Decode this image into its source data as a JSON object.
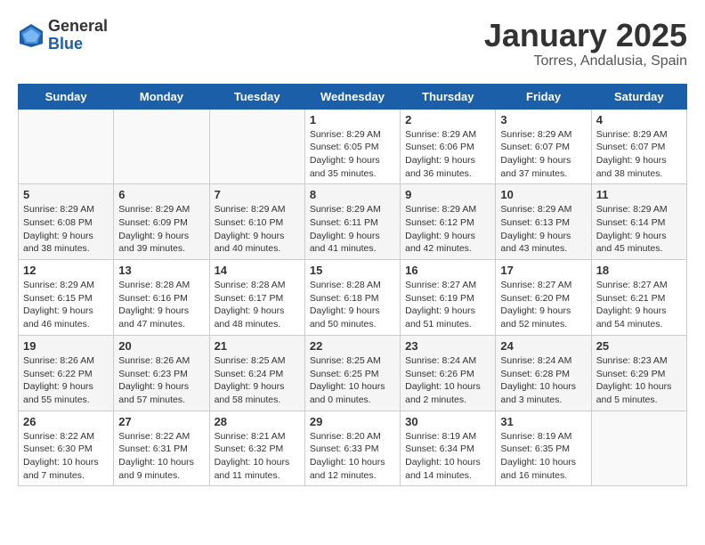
{
  "header": {
    "logo_general": "General",
    "logo_blue": "Blue",
    "month_title": "January 2025",
    "location": "Torres, Andalusia, Spain"
  },
  "days_of_week": [
    "Sunday",
    "Monday",
    "Tuesday",
    "Wednesday",
    "Thursday",
    "Friday",
    "Saturday"
  ],
  "weeks": [
    {
      "shaded": false,
      "days": [
        {
          "num": "",
          "info": ""
        },
        {
          "num": "",
          "info": ""
        },
        {
          "num": "",
          "info": ""
        },
        {
          "num": "1",
          "info": "Sunrise: 8:29 AM\nSunset: 6:05 PM\nDaylight: 9 hours\nand 35 minutes."
        },
        {
          "num": "2",
          "info": "Sunrise: 8:29 AM\nSunset: 6:06 PM\nDaylight: 9 hours\nand 36 minutes."
        },
        {
          "num": "3",
          "info": "Sunrise: 8:29 AM\nSunset: 6:07 PM\nDaylight: 9 hours\nand 37 minutes."
        },
        {
          "num": "4",
          "info": "Sunrise: 8:29 AM\nSunset: 6:07 PM\nDaylight: 9 hours\nand 38 minutes."
        }
      ]
    },
    {
      "shaded": true,
      "days": [
        {
          "num": "5",
          "info": "Sunrise: 8:29 AM\nSunset: 6:08 PM\nDaylight: 9 hours\nand 38 minutes."
        },
        {
          "num": "6",
          "info": "Sunrise: 8:29 AM\nSunset: 6:09 PM\nDaylight: 9 hours\nand 39 minutes."
        },
        {
          "num": "7",
          "info": "Sunrise: 8:29 AM\nSunset: 6:10 PM\nDaylight: 9 hours\nand 40 minutes."
        },
        {
          "num": "8",
          "info": "Sunrise: 8:29 AM\nSunset: 6:11 PM\nDaylight: 9 hours\nand 41 minutes."
        },
        {
          "num": "9",
          "info": "Sunrise: 8:29 AM\nSunset: 6:12 PM\nDaylight: 9 hours\nand 42 minutes."
        },
        {
          "num": "10",
          "info": "Sunrise: 8:29 AM\nSunset: 6:13 PM\nDaylight: 9 hours\nand 43 minutes."
        },
        {
          "num": "11",
          "info": "Sunrise: 8:29 AM\nSunset: 6:14 PM\nDaylight: 9 hours\nand 45 minutes."
        }
      ]
    },
    {
      "shaded": false,
      "days": [
        {
          "num": "12",
          "info": "Sunrise: 8:29 AM\nSunset: 6:15 PM\nDaylight: 9 hours\nand 46 minutes."
        },
        {
          "num": "13",
          "info": "Sunrise: 8:28 AM\nSunset: 6:16 PM\nDaylight: 9 hours\nand 47 minutes."
        },
        {
          "num": "14",
          "info": "Sunrise: 8:28 AM\nSunset: 6:17 PM\nDaylight: 9 hours\nand 48 minutes."
        },
        {
          "num": "15",
          "info": "Sunrise: 8:28 AM\nSunset: 6:18 PM\nDaylight: 9 hours\nand 50 minutes."
        },
        {
          "num": "16",
          "info": "Sunrise: 8:27 AM\nSunset: 6:19 PM\nDaylight: 9 hours\nand 51 minutes."
        },
        {
          "num": "17",
          "info": "Sunrise: 8:27 AM\nSunset: 6:20 PM\nDaylight: 9 hours\nand 52 minutes."
        },
        {
          "num": "18",
          "info": "Sunrise: 8:27 AM\nSunset: 6:21 PM\nDaylight: 9 hours\nand 54 minutes."
        }
      ]
    },
    {
      "shaded": true,
      "days": [
        {
          "num": "19",
          "info": "Sunrise: 8:26 AM\nSunset: 6:22 PM\nDaylight: 9 hours\nand 55 minutes."
        },
        {
          "num": "20",
          "info": "Sunrise: 8:26 AM\nSunset: 6:23 PM\nDaylight: 9 hours\nand 57 minutes."
        },
        {
          "num": "21",
          "info": "Sunrise: 8:25 AM\nSunset: 6:24 PM\nDaylight: 9 hours\nand 58 minutes."
        },
        {
          "num": "22",
          "info": "Sunrise: 8:25 AM\nSunset: 6:25 PM\nDaylight: 10 hours\nand 0 minutes."
        },
        {
          "num": "23",
          "info": "Sunrise: 8:24 AM\nSunset: 6:26 PM\nDaylight: 10 hours\nand 2 minutes."
        },
        {
          "num": "24",
          "info": "Sunrise: 8:24 AM\nSunset: 6:28 PM\nDaylight: 10 hours\nand 3 minutes."
        },
        {
          "num": "25",
          "info": "Sunrise: 8:23 AM\nSunset: 6:29 PM\nDaylight: 10 hours\nand 5 minutes."
        }
      ]
    },
    {
      "shaded": false,
      "days": [
        {
          "num": "26",
          "info": "Sunrise: 8:22 AM\nSunset: 6:30 PM\nDaylight: 10 hours\nand 7 minutes."
        },
        {
          "num": "27",
          "info": "Sunrise: 8:22 AM\nSunset: 6:31 PM\nDaylight: 10 hours\nand 9 minutes."
        },
        {
          "num": "28",
          "info": "Sunrise: 8:21 AM\nSunset: 6:32 PM\nDaylight: 10 hours\nand 11 minutes."
        },
        {
          "num": "29",
          "info": "Sunrise: 8:20 AM\nSunset: 6:33 PM\nDaylight: 10 hours\nand 12 minutes."
        },
        {
          "num": "30",
          "info": "Sunrise: 8:19 AM\nSunset: 6:34 PM\nDaylight: 10 hours\nand 14 minutes."
        },
        {
          "num": "31",
          "info": "Sunrise: 8:19 AM\nSunset: 6:35 PM\nDaylight: 10 hours\nand 16 minutes."
        },
        {
          "num": "",
          "info": ""
        }
      ]
    }
  ]
}
